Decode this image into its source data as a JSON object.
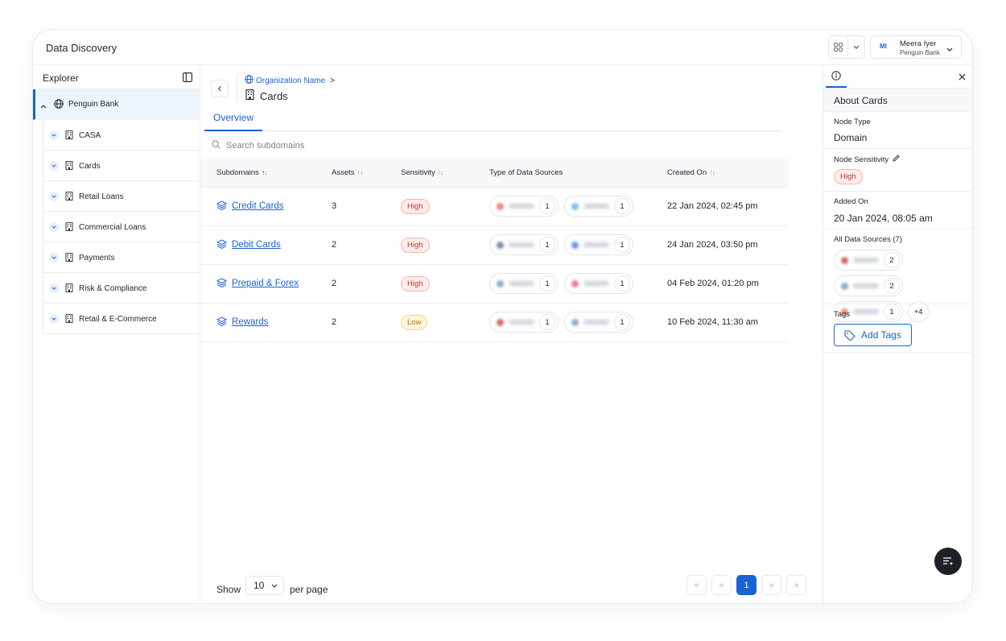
{
  "app": {
    "title": "Data Discovery"
  },
  "user": {
    "initials": "MI",
    "name": "Meera Iyer",
    "org": "Penguin Bank"
  },
  "explorer": {
    "title": "Explorer",
    "root": "Penguin Bank",
    "items": [
      "CASA",
      "Cards",
      "Retail Loans",
      "Commercial Loans",
      "Payments",
      "Risk & Compliance",
      "Retail & E-Commerce"
    ]
  },
  "breadcrumb": {
    "org": "Organization Name",
    "separator": ">"
  },
  "page": {
    "title": "Cards"
  },
  "tabs": [
    "Overview"
  ],
  "search": {
    "placeholder": "Search subdomains"
  },
  "table": {
    "columns": [
      "Subdomains",
      "Assets",
      "Sensitivity",
      "Type of Data Sources",
      "Created On"
    ],
    "rows": [
      {
        "name": "Credit Cards",
        "assets": "3",
        "sensitivity": "High",
        "level": "high",
        "sources": [
          {
            "color": "#e85b5b",
            "count": "1"
          },
          {
            "color": "#4aa8e0",
            "count": "1"
          }
        ],
        "created": "22 Jan 2024, 02:45 pm"
      },
      {
        "name": "Debit Cards",
        "assets": "2",
        "sensitivity": "High",
        "level": "high",
        "sources": [
          {
            "color": "#4b6b95",
            "count": "1"
          },
          {
            "color": "#3b73e8",
            "count": "1"
          }
        ],
        "created": "24 Jan 2024, 03:50 pm"
      },
      {
        "name": "Prepaid & Forex",
        "assets": "2",
        "sensitivity": "High",
        "level": "high",
        "sources": [
          {
            "color": "#6a8fb0",
            "count": "1"
          },
          {
            "color": "#e84a6a",
            "count": "1"
          }
        ],
        "created": "04 Feb 2024, 01:20 pm"
      },
      {
        "name": "Rewards",
        "assets": "2",
        "sensitivity": "Low",
        "level": "low",
        "sources": [
          {
            "color": "#c0392b",
            "count": "1"
          },
          {
            "color": "#6a8fb0",
            "count": "1"
          }
        ],
        "created": "10 Feb 2024, 11:30 am"
      }
    ]
  },
  "pagination": {
    "show_label": "Show",
    "per_page_value": "10",
    "per_page_label": "per page",
    "current_page": "1",
    "first": "«",
    "prev": "«",
    "next": "»",
    "last": "»"
  },
  "about": {
    "title": "About Cards",
    "node_type_label": "Node Type",
    "node_type": "Domain",
    "sensitivity_label": "Node Sensitivity",
    "sensitivity": "High",
    "added_label": "Added On",
    "added_on": "20 Jan 2024, 08:05 am",
    "sources_label": "All Data Sources (7)",
    "sources": [
      {
        "color": "#c0392b",
        "count": "2"
      },
      {
        "color": "#6a8fb0",
        "count": "2"
      },
      {
        "color": "#e85b5b",
        "count": "1"
      }
    ],
    "more_sources": "+4",
    "tags_label": "Tags",
    "add_tags": "Add Tags"
  }
}
